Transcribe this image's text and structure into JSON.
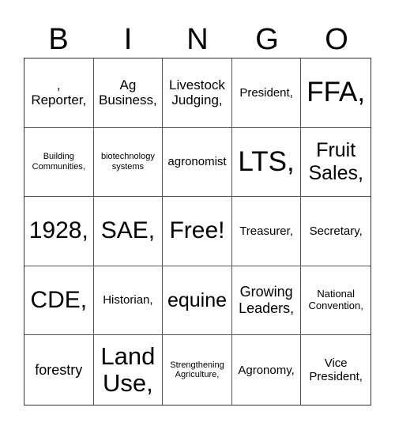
{
  "header": [
    "B",
    "I",
    "N",
    "G",
    "O"
  ],
  "cells": [
    ",\nReporter,",
    "Ag\nBusiness,",
    "Livestock\nJudging,",
    "President,",
    "FFA,",
    "Building\nCommunities,",
    "biotechnology\nsystems",
    "agronomist",
    "LTS,",
    "Fruit\nSales,",
    "1928,",
    "SAE,",
    "Free!",
    "Treasurer,",
    "Secretary,",
    "CDE,",
    "Historian,",
    "equine",
    "Growing\nLeaders,",
    "National\nConvention,",
    "forestry",
    "Land\nUse,",
    "Strengthening\nAgriculture,",
    "Agronomy,",
    "Vice\nPresident,"
  ]
}
